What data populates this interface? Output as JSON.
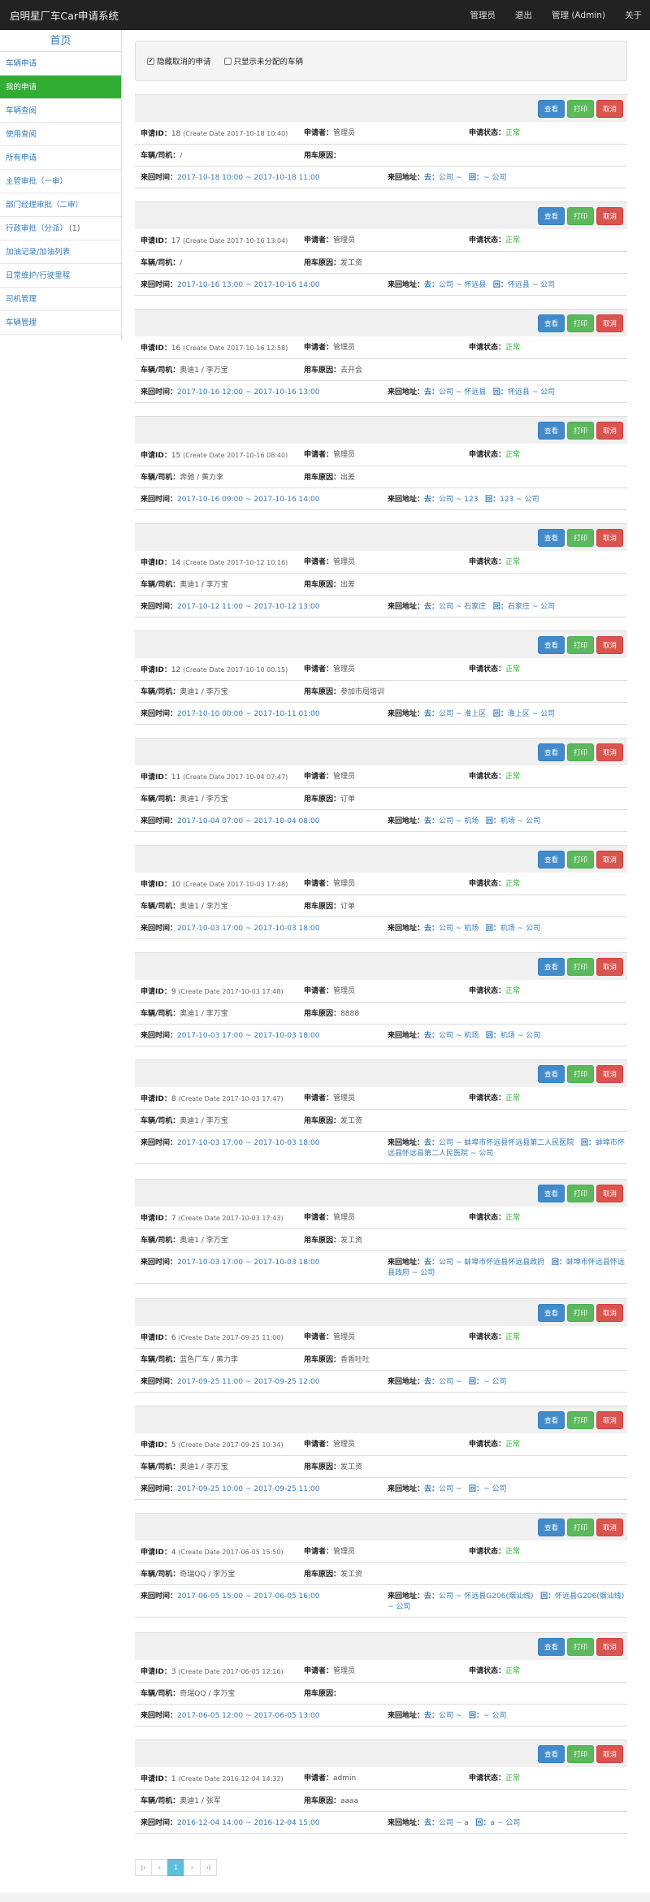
{
  "app_title": "启明星厂车Car申请系统",
  "nav": {
    "user": "管理员",
    "logout": "退出",
    "admin": "管理 (Admin)",
    "about": "关于"
  },
  "sidebar": {
    "home": "首页",
    "items": [
      "车辆申请",
      "我的申请",
      "车辆查阅",
      "使用查阅",
      "所有申请",
      "主管审批（一审）",
      "部门经理审批（二审）",
      "行政审批（分派）",
      "加油记录/加油列表",
      "日常维护/行驶里程",
      "司机管理",
      "车辆管理"
    ],
    "badge": "(1)"
  },
  "filter": {
    "hide_cancelled": "隐藏取消的申请",
    "only_unassigned": "只显示未分配的车辆",
    "check_mark": "✔"
  },
  "buttons": {
    "view": "查看",
    "print": "打印",
    "cancel": "取消"
  },
  "labels": {
    "id": "申请ID：",
    "applicant": "申请者：",
    "status": "申请状态：",
    "vehicle": "车辆/司机：",
    "reason": "用车原因：",
    "time": "来回时间：",
    "address": "来回地址：",
    "go": "去：",
    "back": "回："
  },
  "records": [
    {
      "id": "18",
      "create": "(Create Date 2017-10-18 10:40)",
      "applicant": "管理员",
      "status": "正常",
      "vehicle": "/",
      "reason": "",
      "time": "2017-10-18 10:00 ~ 2017-10-18 11:00",
      "go": "公司 ~",
      "back": "~ 公司"
    },
    {
      "id": "17",
      "create": "(Create Date 2017-10-16 13:04)",
      "applicant": "管理员",
      "status": "正常",
      "vehicle": "/",
      "reason": "发工资",
      "time": "2017-10-16 13:00 ~ 2017-10-16 14:00",
      "go": "公司 ~ 怀远县",
      "back": "怀远县 ~ 公司"
    },
    {
      "id": "16",
      "create": "(Create Date 2017-10-16 12:58)",
      "applicant": "管理员",
      "status": "正常",
      "vehicle": "奥迪1 / 李万宝",
      "reason": "去开会",
      "time": "2017-10-16 12:00 ~ 2017-10-16 13:00",
      "go": "公司 ~ 怀远县",
      "back": "怀远县 ~ 公司"
    },
    {
      "id": "15",
      "create": "(Create Date 2017-10-16 08:40)",
      "applicant": "管理员",
      "status": "正常",
      "vehicle": "奔驰 / 黄力李",
      "reason": "出差",
      "time": "2017-10-16 09:00 ~ 2017-10-16 14:00",
      "go": "公司 ~ 123",
      "back": "123 ~ 公司"
    },
    {
      "id": "14",
      "create": "(Create Date 2017-10-12 10:16)",
      "applicant": "管理员",
      "status": "正常",
      "vehicle": "奥迪1 / 李万宝",
      "reason": "出差",
      "time": "2017-10-12 11:00 ~ 2017-10-12 13:00",
      "go": "公司 ~ 石家庄",
      "back": "石家庄 ~ 公司"
    },
    {
      "id": "12",
      "create": "(Create Date 2017-10-10 00:15)",
      "applicant": "管理员",
      "status": "正常",
      "vehicle": "奥迪1 / 李万宝",
      "reason": "参加市局培训",
      "time": "2017-10-10 00:00 ~ 2017-10-11 01:00",
      "go": "公司 ~ 淮上区",
      "back": "淮上区 ~ 公司"
    },
    {
      "id": "11",
      "create": "(Create Date 2017-10-04 07:47)",
      "applicant": "管理员",
      "status": "正常",
      "vehicle": "奥迪1 / 李万宝",
      "reason": "订单",
      "time": "2017-10-04 07:00 ~ 2017-10-04 08:00",
      "go": "公司 ~ 机场",
      "back": "机场 ~ 公司"
    },
    {
      "id": "10",
      "create": "(Create Date 2017-10-03 17:48)",
      "applicant": "管理员",
      "status": "正常",
      "vehicle": "奥迪1 / 李万宝",
      "reason": "订单",
      "time": "2017-10-03 17:00 ~ 2017-10-03 18:00",
      "go": "公司 ~ 机场",
      "back": "机场 ~ 公司"
    },
    {
      "id": "9",
      "create": "(Create Date 2017-10-03 17:48)",
      "applicant": "管理员",
      "status": "正常",
      "vehicle": "奥迪1 / 李万宝",
      "reason": "8888",
      "time": "2017-10-03 17:00 ~ 2017-10-03 18:00",
      "go": "公司 ~ 机场",
      "back": "机场 ~ 公司"
    },
    {
      "id": "8",
      "create": "(Create Date 2017-10-03 17:47)",
      "applicant": "管理员",
      "status": "正常",
      "vehicle": "奥迪1 / 李万宝",
      "reason": "发工资",
      "time": "2017-10-03 17:00 ~ 2017-10-03 18:00",
      "go": "公司 ~ 蚌埠市怀远县怀远县第二人民医院",
      "back": "蚌埠市怀远县怀远县第二人民医院 ~ 公司"
    },
    {
      "id": "7",
      "create": "(Create Date 2017-10-03 17:43)",
      "applicant": "管理员",
      "status": "正常",
      "vehicle": "奥迪1 / 李万宝",
      "reason": "发工资",
      "time": "2017-10-03 17:00 ~ 2017-10-03 18:00",
      "go": "公司 ~ 蚌埠市怀远县怀远县政府",
      "back": "蚌埠市怀远县怀远县政府 ~ 公司"
    },
    {
      "id": "6",
      "create": "(Create Date 2017-09-25 11:00)",
      "applicant": "管理员",
      "status": "正常",
      "vehicle": "蓝色厂车 / 黄力李",
      "reason": "香香吐吐",
      "time": "2017-09-25 11:00 ~ 2017-09-25 12:00",
      "go": "公司 ~",
      "back": "~ 公司"
    },
    {
      "id": "5",
      "create": "(Create Date 2017-09-25 10:34)",
      "applicant": "管理员",
      "status": "正常",
      "vehicle": "奥迪1 / 李万宝",
      "reason": "发工资",
      "time": "2017-09-25 10:00 ~ 2017-09-25 11:00",
      "go": "公司 ~",
      "back": "~ 公司"
    },
    {
      "id": "4",
      "create": "(Create Date 2017-06-05 15:50)",
      "applicant": "管理员",
      "status": "正常",
      "vehicle": "奇瑞QQ / 李万宝",
      "reason": "发工资",
      "time": "2017-06-05 15:00 ~ 2017-06-05 16:00",
      "go": "公司 ~ 怀远县G206(烟汕线)",
      "back": "怀远县G206(烟汕线) ~ 公司"
    },
    {
      "id": "3",
      "create": "(Create Date 2017-06-05 12:16)",
      "applicant": "管理员",
      "status": "正常",
      "vehicle": "奇瑞QQ / 李万宝",
      "reason": "",
      "time": "2017-06-05 12:00 ~ 2017-06-05 13:00",
      "go": "公司 ~",
      "back": "~ 公司"
    },
    {
      "id": "1",
      "create": "(Create Date 2016-12-04 14:32)",
      "applicant": "admin",
      "status": "正常",
      "vehicle": "奥迪1 / 张军",
      "reason": "aaaa",
      "time": "2016-12-04 14:00 ~ 2016-12-04 15:00",
      "go": "公司 ~ a",
      "back": "a ~ 公司"
    }
  ],
  "pager": [
    "|‹",
    "‹",
    "1",
    "›",
    "›|"
  ]
}
